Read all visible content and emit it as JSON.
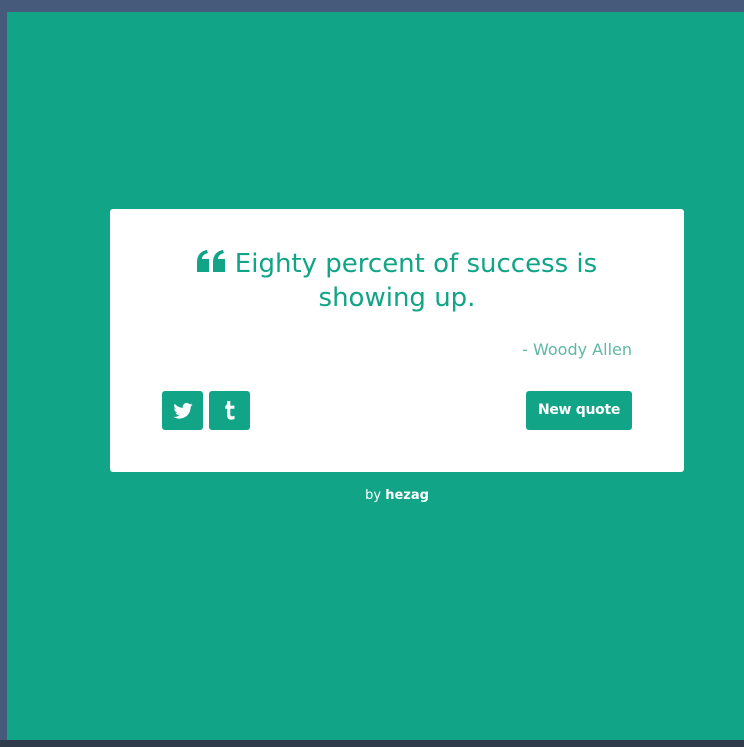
{
  "quote": {
    "text": "Eighty percent of success is showing up.",
    "author": "- Woody Allen",
    "icon": "quote-left-icon"
  },
  "actions": {
    "twitter_icon": "twitter-icon",
    "tumblr_icon": "tumblr-icon",
    "new_quote_label": "New quote"
  },
  "footer": {
    "prefix": "by",
    "name": "hezag"
  },
  "colors": {
    "accent": "#11a486",
    "card": "#ffffff",
    "frame": "#465a7c"
  }
}
